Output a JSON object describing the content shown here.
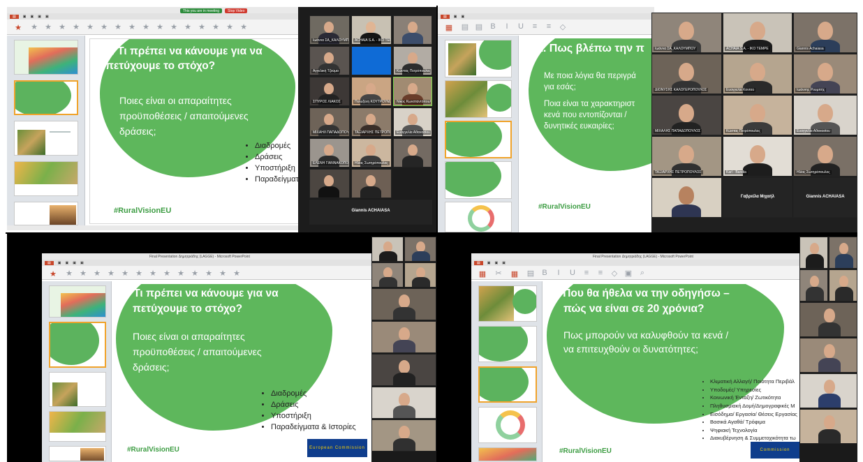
{
  "q1": {
    "zoom_bar": {
      "recording_label": "This you are in meeting",
      "stop_label": "Stop Video"
    },
    "slide": {
      "title_line1": "3. Τι πρέπει να κάνουμε για να",
      "title_line2": "πετύχουμε το στόχο?",
      "sub_line1": "Ποιες είναι οι απαραίτητες",
      "sub_line2": "προϋποθέσεις / απαιτούμενες",
      "sub_line3": "δράσεις;",
      "bullets": [
        "Διαδρομές",
        "Δράσεις",
        "Υποστήριξη",
        "Παραδείγματα"
      ],
      "hashtag": "#RuralVisionEU"
    },
    "participants": [
      "Ιωάννα ΣΑ_ΚΑΛΟΥΜΠΟΥ...",
      "ACHAIA S.A. - IKO TEMPE",
      "",
      "Αγγελική Τζούμα",
      "",
      "Κώστας Πετρόπουλος",
      "",
      "ΣΠΥΡΟΣ ΛΙΑΚΟΣ",
      "Πολυξένη ΚΟΥΤΡΟΥΜΑΝΗ",
      "Νίκος Κωνσταντόπουλος",
      "",
      "ΜΙΧΑΗΛ ΠΑΠΑΔΟΠΟΥΛΟΣ",
      "ΤΑΞΙΑΡΧΗΣ ΠΕΤΡΟΠΟΥΛΟΣ",
      "Ευαγγελία Αθανασίου",
      "ΕΛΕΝΗ ΓΙΑΝΝΑΚΟΠΟΥΛΟΥ - Π.Ε.",
      "Ηλίας Σωτηρόπουλος"
    ],
    "active_speaker": "Giannis ACHAIASA"
  },
  "q2": {
    "slide": {
      "title": "1. Πως βλέπω την π",
      "sub_line1": "Με ποια λόγια θα περιγρά",
      "sub_line2": "για εσάς;",
      "sub_line3": "Ποια είναι τα χαρακτηριστ",
      "sub_line4": "κενά που εντοπίζονται /",
      "sub_line5": "δυνητικές ευκαιρίες;",
      "hashtag": "#RuralVisionEU"
    },
    "participants": [
      "Ιωάννα ΣΑ_ΚΑΛΟΥΜΠΟΥ",
      "ACHAIA S.A. - IKO TEMPE",
      "Giannis Achaiasa",
      "ΣΠΥΡΟΣ ΛΙΑΚΟΣ",
      "Ελένη Καλοφωτιά",
      "Μιχάλης Πυροβολάκης",
      "ΔΙΟΝΥΣΗΣ ΚΑΛΟΓΕΡΟΠΟΥΛΟΣ",
      "Ευαγγελία Κοντού",
      "Κωνσταντίνα Μπρουσκού",
      "Ιωάννης Ρουμπής",
      "ΜΙΧΑΛΗΣ ΠΑΠΑΔΟΠΟΥΛΟΣ",
      "Ελένη Θεοχαρίδου",
      "Κώστας Πετρόπουλος",
      "Ευαγγελία Αθανασίου",
      "ΤΑΞΙΑΡΧΗΣ ΠΕΤΡΟΠΟΥΛΟΣ",
      "Karl - Bandia",
      "Ηλίας Σωτηρόπουλος",
      "",
      "Γαβριέλα Μιχαήλ",
      "Giannis ACHAIASA"
    ]
  },
  "q3": {
    "window_title": "Final Presentation Δημητριάδης (LAGGE) - Microsoft PowerPoint",
    "slide": {
      "title_line1": "3. Τι πρέπει να κάνουμε για να",
      "title_line2": "πετύχουμε το στόχο?",
      "sub_line1": "Ποιες είναι οι απαραίτητες",
      "sub_line2": "προϋποθέσεις / απαιτούμενες",
      "sub_line3": "δράσεις;",
      "bullets": [
        "Διαδρομές",
        "Δράσεις",
        "Υποστήριξη",
        "Παραδείγματα & Ιστορίες"
      ],
      "hashtag": "#RuralVisionEU",
      "eu_label": "European Commission"
    }
  },
  "q4": {
    "window_title": "Final Presentation Δημητριάδης (LAGGE) - Microsoft PowerPoint",
    "slide": {
      "title_line1": "2. Που θα ήθελα να την οδηγήσω –",
      "title_line2": "πώς να είναι σε 20 χρόνια?",
      "sub_line1": "Πως μπορούν να καλυφθούν τα κενά /",
      "sub_line2": "να επιτευχθούν οι δυνατότητες;",
      "bullets": [
        "Κλιματική Αλλαγή/ Ποιότητα Περιβάλ",
        "Υποδομές/ Υπηρεσίες",
        "Κοινωνική Ένταξη/ Ζωτικότητα",
        "Πληθυσμιακή Δομή/Δημογραφικές Μ",
        "Εισόδημα/ Εργασία/ Θέσεις Εργασίας",
        "Βασικά Αγαθά/ Τρόφιμα",
        "Ψηφιακή Τεχνολογία",
        "Διακυβέρνηση & Συμμετοχικότητα τω"
      ],
      "hashtag": "#RuralVisionEU",
      "eu_label": "Commission"
    }
  },
  "colors": {
    "slide_green": "#5eb75c",
    "hashtag_green": "#3c9c42",
    "eu_blue": "#0f3d8c",
    "ppt_orange": "#c8462a"
  }
}
